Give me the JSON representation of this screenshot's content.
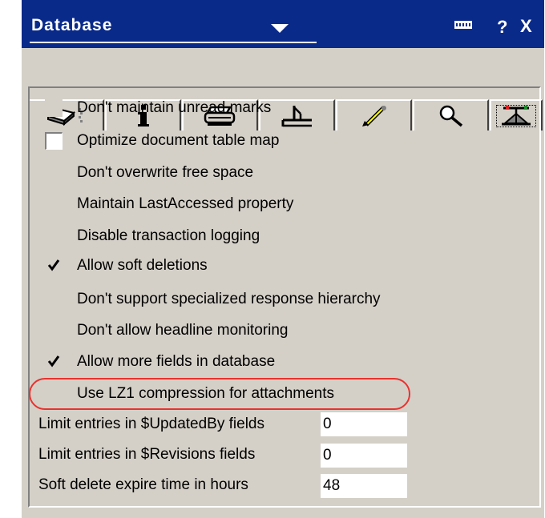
{
  "window": {
    "title": "Database",
    "help_glyph": "?",
    "close_glyph": "X"
  },
  "tabs": [
    {
      "icon": "database-book-icon",
      "active": false
    },
    {
      "icon": "info-icon",
      "label": "i",
      "active": false
    },
    {
      "icon": "printer-icon",
      "active": false
    },
    {
      "icon": "hat-icon",
      "active": false
    },
    {
      "icon": "design-brush-icon",
      "active": false
    },
    {
      "icon": "search-icon",
      "active": false
    },
    {
      "icon": "advanced-propeller-icon",
      "active": true
    }
  ],
  "options": [
    {
      "label": "Don't maintain unread marks",
      "checked": false,
      "white_box": false
    },
    {
      "label": "Optimize document table map",
      "checked": false,
      "white_box": true
    },
    {
      "label": "Don't overwrite free space",
      "checked": false,
      "white_box": false
    },
    {
      "label": "Maintain LastAccessed property",
      "checked": false,
      "white_box": false
    },
    {
      "label": "Disable transaction logging",
      "checked": false,
      "white_box": false
    },
    {
      "label": "Allow soft deletions",
      "checked": true,
      "white_box": false
    },
    {
      "label": "Don't support specialized response hierarchy",
      "checked": false,
      "white_box": false
    },
    {
      "label": "Don't allow headline monitoring",
      "checked": false,
      "white_box": false
    },
    {
      "label": "Allow more fields in database",
      "checked": true,
      "white_box": false
    },
    {
      "label": "Use LZ1 compression for attachments",
      "checked": false,
      "white_box": false
    }
  ],
  "fields": [
    {
      "label": "Limit entries in $UpdatedBy fields",
      "value": "0"
    },
    {
      "label": "Limit entries in $Revisions fields",
      "value": "0"
    },
    {
      "label": "Soft delete expire time in hours",
      "value": "48"
    }
  ],
  "colors": {
    "titlebar": "#0a2a8a",
    "face": "#d4d0c8",
    "highlight_ring": "#e8322e"
  }
}
